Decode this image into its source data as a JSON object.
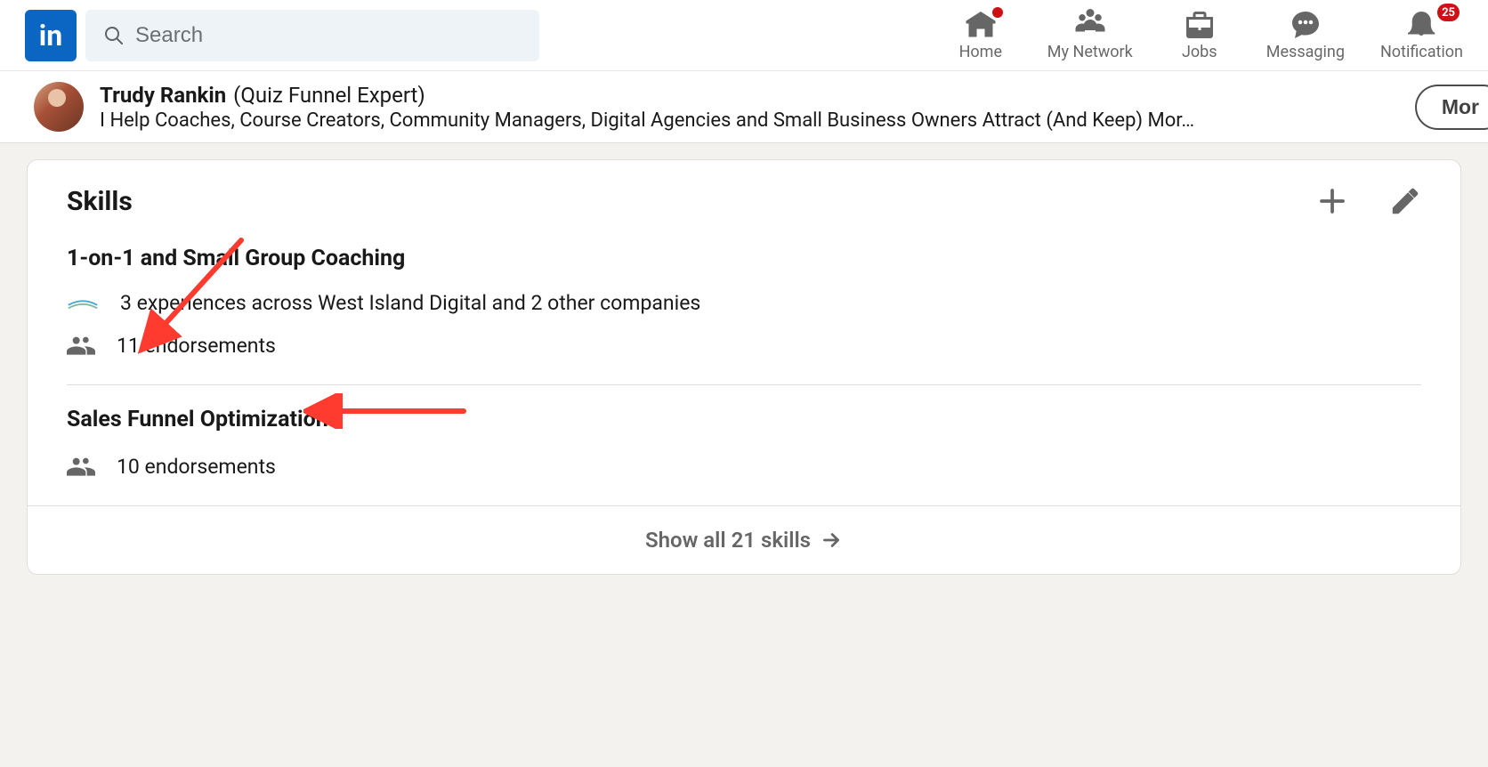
{
  "search": {
    "placeholder": "Search"
  },
  "nav": {
    "home": "Home",
    "network": "My Network",
    "jobs": "Jobs",
    "messaging": "Messaging",
    "notifications": "Notification",
    "notifications_badge": "25"
  },
  "profile": {
    "name": "Trudy Rankin",
    "suffix": "(Quiz Funnel Expert)",
    "headline": "I Help Coaches, Course Creators, Community Managers, Digital Agencies and Small Business Owners Attract (And Keep) Mor…",
    "more_button": "Mor"
  },
  "skills_section": {
    "title": "Skills",
    "skills": [
      {
        "name": "1-on-1 and Small Group Coaching",
        "experience_text": "3 experiences across West Island Digital and 2 other companies",
        "endorsements": "11 endorsements"
      },
      {
        "name": "Sales Funnel Optimization",
        "endorsements": "10 endorsements"
      }
    ],
    "show_all": "Show all 21 skills"
  }
}
